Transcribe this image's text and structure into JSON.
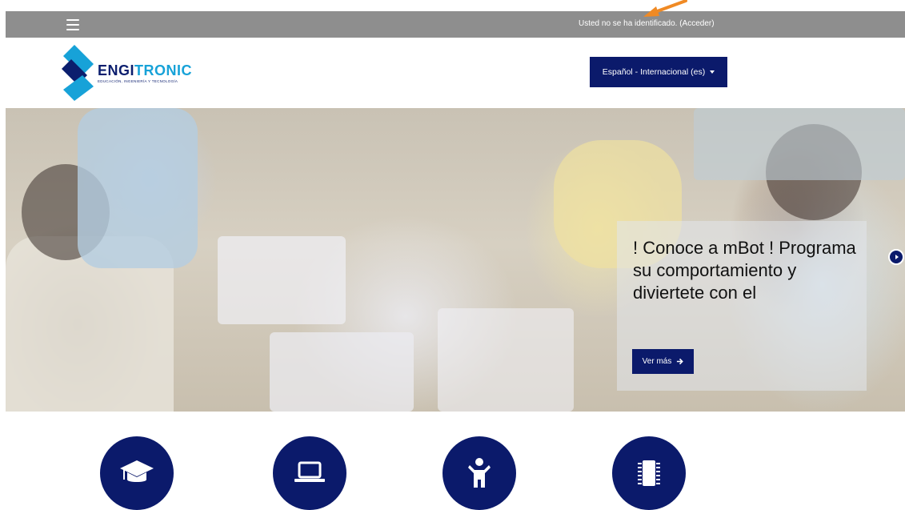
{
  "topbar": {
    "menu_icon": "hamburger-menu-icon",
    "login_status": "Usted no se ha identificado.",
    "login_link": "(Acceder)",
    "annotation_arrow_color": "#f08a24"
  },
  "brand": {
    "name_part1": "ENGI",
    "name_part2": "TRONIC",
    "tagline": "EDUCACIÓN, INGENIERÍA Y TECNOLOGÍA",
    "primary_color": "#0b1e6e",
    "accent_color": "#17a2d8"
  },
  "language": {
    "selected": "Español - Internacional (es)"
  },
  "carousel": {
    "caption": "! Conoce a mBot ! Programa su comportamiento y diviertete con el",
    "more_button": "Ver más",
    "next_icon": "carousel-next-icon"
  },
  "features": [
    {
      "icon": "graduation-cap-icon"
    },
    {
      "icon": "laptop-icon"
    },
    {
      "icon": "child-icon"
    },
    {
      "icon": "microchip-icon"
    }
  ],
  "colors": {
    "topbar": "#8e8e8e",
    "button": "#0b1a6b"
  }
}
